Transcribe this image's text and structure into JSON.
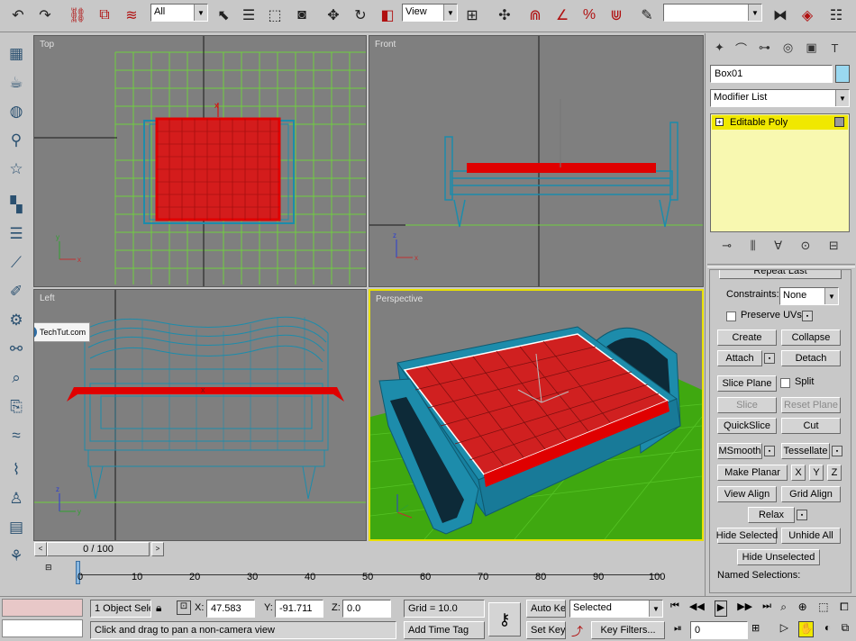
{
  "toolbar": {
    "selection_filter": "All",
    "ref_coord": "View",
    "named_selection": "",
    "icons": [
      "undo-icon",
      "redo-icon",
      "select-link-icon",
      "unlink-icon",
      "bind-space-warp-icon",
      "select-object-icon",
      "select-by-name-icon",
      "rect-selection-icon",
      "window-crossing-icon",
      "move-icon",
      "rotate-icon",
      "scale-icon",
      "manipulate-icon",
      "snap-3-icon",
      "angle-snap-icon",
      "percent-snap-icon",
      "spinner-snap-icon",
      "edit-named-selection-icon",
      "mirror-icon",
      "align-icon",
      "layer-manager-icon"
    ]
  },
  "viewports": {
    "top": {
      "label": "Top"
    },
    "front": {
      "label": "Front"
    },
    "left": {
      "label": "Left"
    },
    "perspective": {
      "label": "Perspective"
    }
  },
  "watermark": "TechTut.com",
  "command_panel": {
    "object_name": "Box01",
    "color_swatch": "#9ad8f0",
    "modifier_list": "Modifier List",
    "stack_item": "Editable Poly",
    "rollout_title": "Repeat Last",
    "constraints_label": "Constraints:",
    "constraints_value": "None",
    "preserve_uvs": "Preserve UVs",
    "create": "Create",
    "collapse": "Collapse",
    "attach": "Attach",
    "detach": "Detach",
    "slice_plane": "Slice Plane",
    "split": "Split",
    "slice": "Slice",
    "reset_plane": "Reset Plane",
    "quickslice": "QuickSlice",
    "cut": "Cut",
    "msmooth": "MSmooth",
    "tessellate": "Tessellate",
    "make_planar": "Make Planar",
    "x": "X",
    "y": "Y",
    "z": "Z",
    "view_align": "View Align",
    "grid_align": "Grid Align",
    "relax": "Relax",
    "hide_selected": "Hide Selected",
    "unhide_all": "Unhide All",
    "hide_unselected": "Hide Unselected",
    "named_selections": "Named Selections:"
  },
  "timeline": {
    "slider_text": "0 / 100",
    "ticks": [
      "0",
      "10",
      "20",
      "30",
      "40",
      "50",
      "60",
      "70",
      "80",
      "90",
      "100"
    ]
  },
  "status": {
    "selection_info": "1 Object Sele",
    "prompt": "Click and drag to pan a non-camera view",
    "x_label": "X:",
    "x_value": "47.583",
    "y_label": "Y:",
    "y_value": "-91.711",
    "z_label": "Z:",
    "z_value": "0.0",
    "grid": "Grid = 10.0",
    "add_time_tag": "Add Time Tag",
    "auto_key": "Auto Key",
    "set_key": "Set Key",
    "key_mode": "Selected",
    "key_filters": "Key Filters...",
    "frame": "0"
  },
  "colors": {
    "viewport_bg": "#7f7f7f",
    "wire": "#1d8cab",
    "selected": "#e00000",
    "grid_green": "#6fcf3f",
    "active_border": "#e8e000",
    "ground": "#3fa810"
  }
}
